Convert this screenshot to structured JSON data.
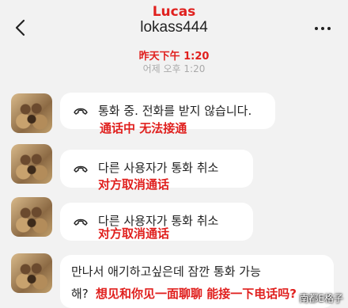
{
  "header": {
    "overlay_name": "Lucas",
    "title": "lokass444",
    "back_icon": "back-arrow-icon",
    "more_icon": "more-dots-icon"
  },
  "timestamp": {
    "chinese": "昨天下午 1:20",
    "korean": "어제 오후 1:20"
  },
  "messages": [
    {
      "icon": "phone-hangup-icon",
      "korean": "통화 중. 전화를 받지 않습니다.",
      "chinese": "通话中 无法接通"
    },
    {
      "icon": "phone-hangup-icon",
      "korean": "다른 사용자가 통화 취소",
      "chinese": "对方取消通话"
    },
    {
      "icon": "phone-hangup-icon",
      "korean": "다른 사용자가 통화 취소",
      "chinese": "对方取消通话"
    },
    {
      "korean_line1": "만나서 애기하고싶은데 잠깐 통화 가능",
      "korean_line2": "해?",
      "chinese": "想见和你见一面聊聊 能接一下电话吗?"
    }
  ],
  "watermark": "南都E格子",
  "colors": {
    "annotation_red": "#e0201e",
    "background": "#f2f2f2",
    "bubble": "#ffffff"
  }
}
